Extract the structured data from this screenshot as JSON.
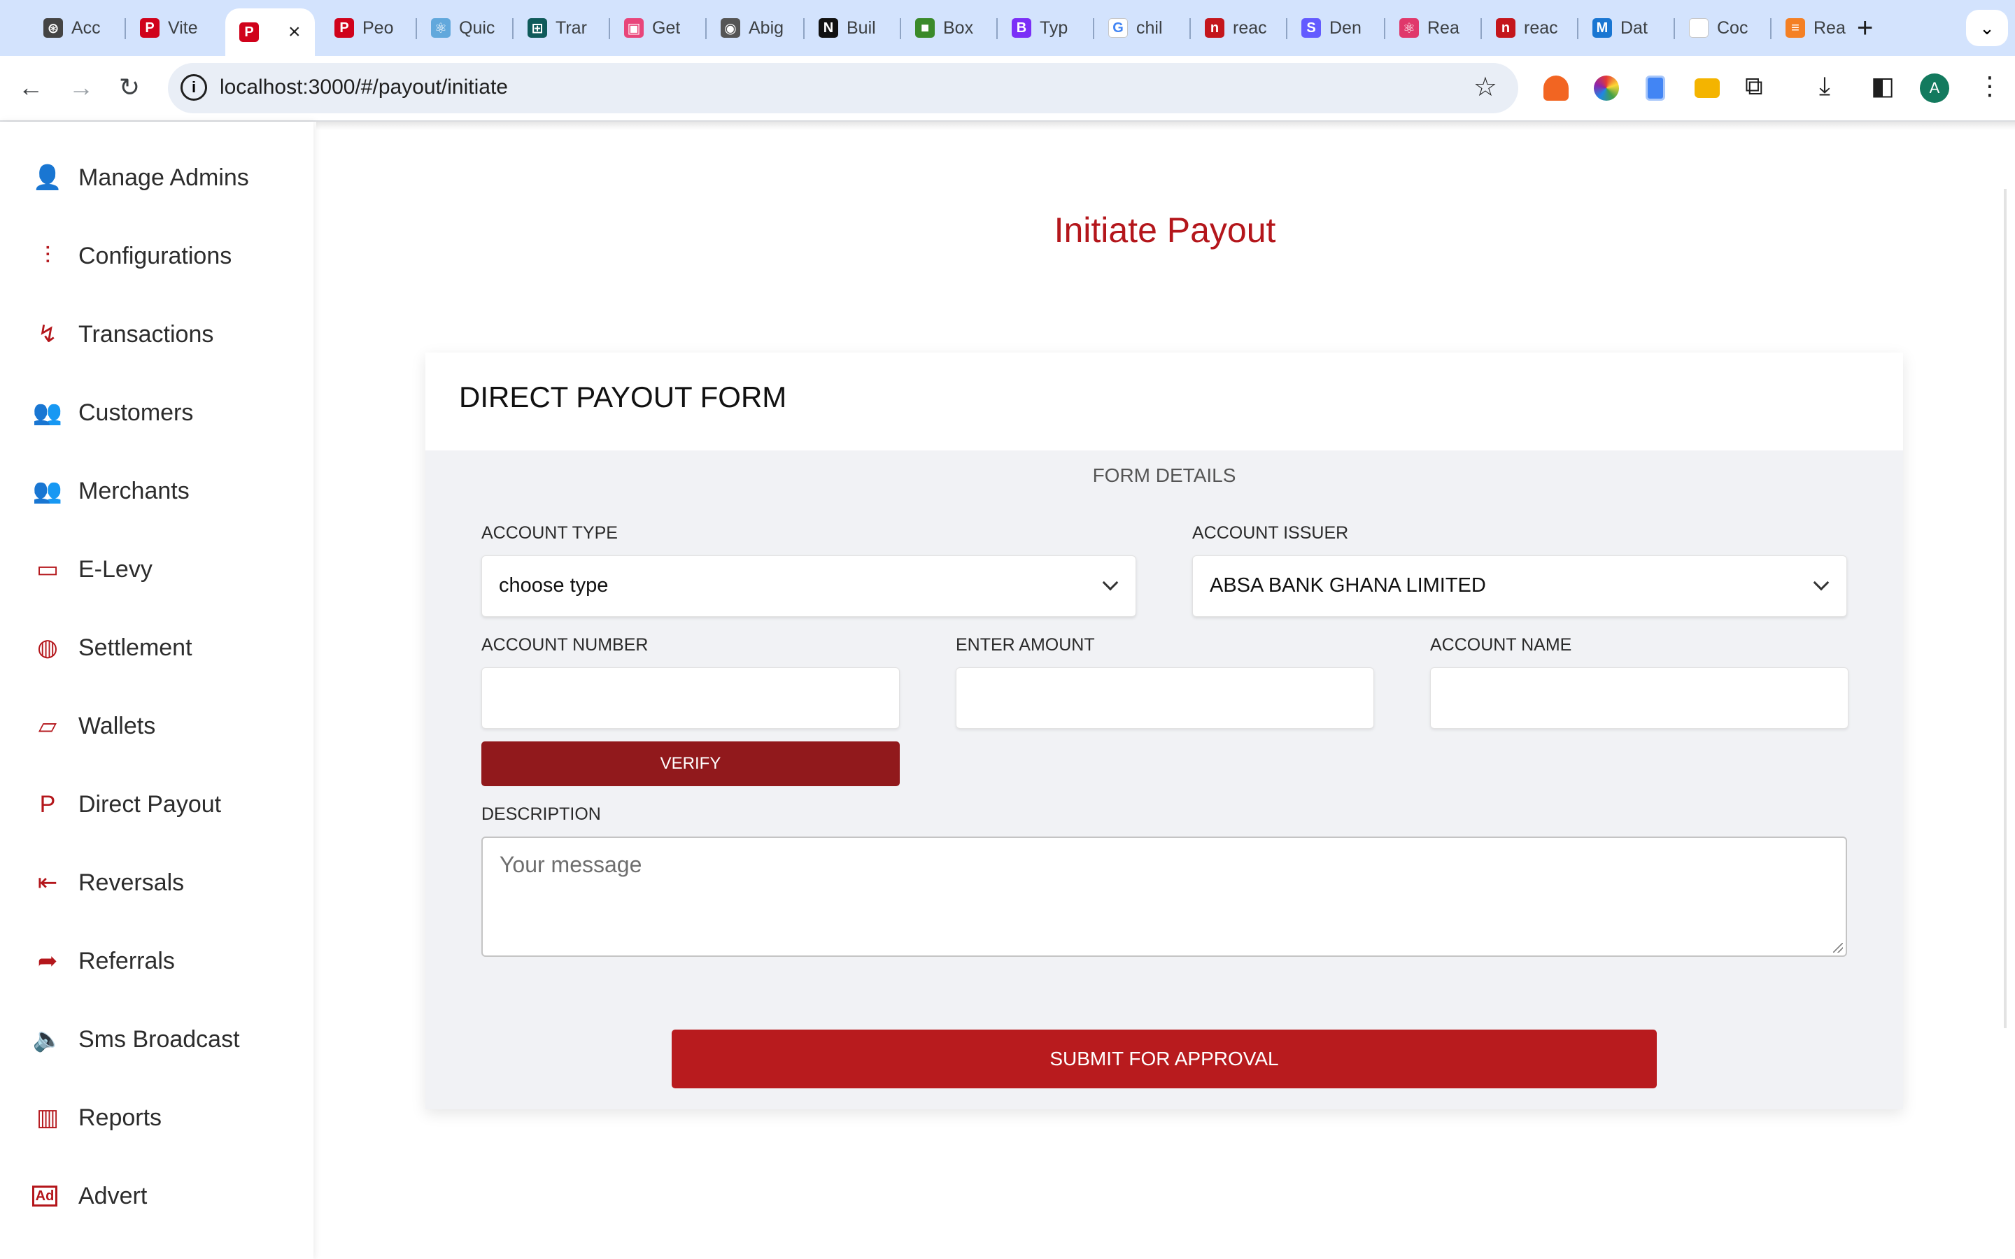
{
  "browser": {
    "tabs": [
      {
        "title": "Acc",
        "icon": "openai-icon",
        "color": "#444444",
        "glyph": "⊛"
      },
      {
        "title": "Vite",
        "icon": "paypal-icon",
        "color": "#d0021b",
        "glyph": "P"
      },
      {
        "title": "",
        "icon": "paypal-icon",
        "color": "#d0021b",
        "glyph": "P",
        "active": true
      },
      {
        "title": "Peo",
        "icon": "paypal-icon",
        "color": "#d0021b",
        "glyph": "P"
      },
      {
        "title": "Quic",
        "icon": "react-icon",
        "color": "#61a8dc",
        "glyph": "⚛"
      },
      {
        "title": "Trar",
        "icon": "transformer-icon",
        "color": "#0f5a5a",
        "glyph": "⊞"
      },
      {
        "title": "Get",
        "icon": "app-icon",
        "color": "#e8457a",
        "glyph": "▣"
      },
      {
        "title": "Abig",
        "icon": "github-icon",
        "color": "#555555",
        "glyph": "◉"
      },
      {
        "title": "Buil",
        "icon": "nextjs-icon",
        "color": "#111111",
        "glyph": "N"
      },
      {
        "title": "Box",
        "icon": "box-icon",
        "color": "#3a8a2a",
        "glyph": "■"
      },
      {
        "title": "Typ",
        "icon": "bootstrap-icon",
        "color": "#7b2ff7",
        "glyph": "B"
      },
      {
        "title": "chil",
        "icon": "google-icon",
        "color": "#ffffff",
        "glyph": "G"
      },
      {
        "title": "reac",
        "icon": "npm-icon",
        "color": "#c4161c",
        "glyph": "n"
      },
      {
        "title": "Den",
        "icon": "stripe-icon",
        "color": "#635bff",
        "glyph": "S"
      },
      {
        "title": "Rea",
        "icon": "react-icon",
        "color": "#e0386b",
        "glyph": "⚛"
      },
      {
        "title": "reac",
        "icon": "npm-icon",
        "color": "#c4161c",
        "glyph": "n"
      },
      {
        "title": "Dat",
        "icon": "mui-icon",
        "color": "#1976d2",
        "glyph": "M"
      },
      {
        "title": "Coc",
        "icon": "blank-page-icon",
        "color": "#ffffff",
        "glyph": ""
      },
      {
        "title": "Rea",
        "icon": "stack-icon",
        "color": "#f48024",
        "glyph": "≡"
      }
    ],
    "url": "localhost:3000/#/payout/initiate",
    "avatar_letter": "A"
  },
  "sidebar": {
    "items": [
      {
        "label": "Manage Admins",
        "icon": "admin-user-icon",
        "glyph": "👤"
      },
      {
        "label": "Configurations",
        "icon": "sliders-icon",
        "glyph": "⫶"
      },
      {
        "label": "Transactions",
        "icon": "transaction-icon",
        "glyph": "↯"
      },
      {
        "label": "Customers",
        "icon": "users-icon",
        "glyph": "👥"
      },
      {
        "label": "Merchants",
        "icon": "users-icon",
        "glyph": "👥"
      },
      {
        "label": "E-Levy",
        "icon": "cash-icon",
        "glyph": "▭"
      },
      {
        "label": "Settlement",
        "icon": "globe-icon",
        "glyph": "◍"
      },
      {
        "label": "Wallets",
        "icon": "wallet-icon",
        "glyph": "▱"
      },
      {
        "label": "Direct Payout",
        "icon": "paypal-icon",
        "glyph": "P"
      },
      {
        "label": "Reversals",
        "icon": "reverse-icon",
        "glyph": "⇤"
      },
      {
        "label": "Referrals",
        "icon": "share-icon",
        "glyph": "➦"
      },
      {
        "label": "Sms Broadcast",
        "icon": "speaker-icon",
        "glyph": "🔈"
      },
      {
        "label": "Reports",
        "icon": "bar-chart-icon",
        "glyph": "▥"
      },
      {
        "label": "Advert",
        "icon": "ad-icon",
        "glyph": "Ad"
      }
    ]
  },
  "page": {
    "title": "Initiate Payout",
    "accent": "#b4161b"
  },
  "form": {
    "title": "DIRECT PAYOUT FORM",
    "section": "FORM DETAILS",
    "account_type": {
      "label": "ACCOUNT TYPE",
      "value": "choose type"
    },
    "account_issuer": {
      "label": "ACCOUNT ISSUER",
      "value": "ABSA BANK GHANA LIMITED"
    },
    "account_number": {
      "label": "ACCOUNT NUMBER",
      "value": ""
    },
    "amount": {
      "label": "ENTER AMOUNT",
      "value": ""
    },
    "account_name": {
      "label": "ACCOUNT NAME",
      "value": ""
    },
    "verify_label": "VERIFY",
    "description": {
      "label": "DESCRIPTION",
      "placeholder": "Your message"
    },
    "submit_label": "SUBMIT FOR APPROVAL"
  }
}
